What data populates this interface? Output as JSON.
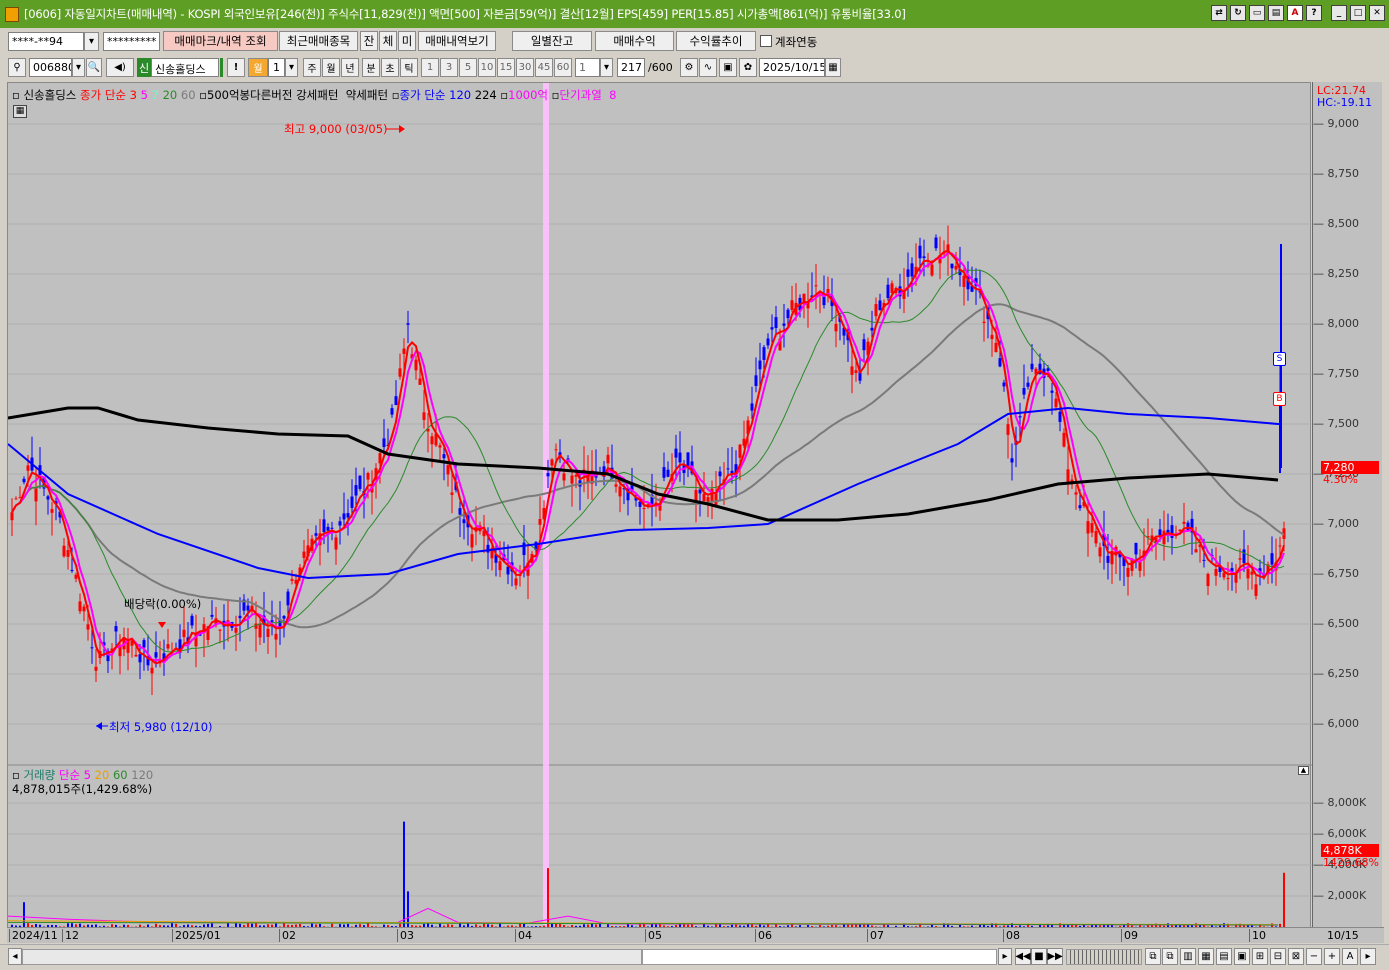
{
  "window": {
    "title": "[0606] 자동일지차트(매매내역) - KOSPI 외국인보유[246(천)] 주식수[11,829(천)] 액면[500] 자본금[59(억)] 결산[12월] EPS[459] PER[15.85] 시가총액[861(억)] 유통비율[33.0]"
  },
  "toolbar1": {
    "account": "****-**94",
    "password": "*********",
    "b1": "매매마크/내역 조회",
    "b2": "최근매매종목",
    "b3": "잔",
    "b4": "체",
    "b5": "미",
    "b6": "매매내역보기",
    "b7": "일별잔고",
    "b8": "매매수익",
    "b9": "수익률추이",
    "check_label": "계좌연동"
  },
  "toolbar2": {
    "code": "006880",
    "badge": "신",
    "name": "신송홀딩스",
    "excl": "!",
    "period_active": "월",
    "period_value": "1",
    "periods": [
      "주",
      "월",
      "년",
      "분",
      "초",
      "틱"
    ],
    "nums": [
      "1",
      "3",
      "5",
      "10",
      "15",
      "30",
      "45",
      "60"
    ],
    "num_sel": "1",
    "count": "217",
    "count_total": "/600",
    "date": "2025/10/15"
  },
  "legend_price": {
    "name": "신송홀딩스",
    "ma_label": "종가 단순",
    "p3": "3",
    "p5": "5",
    "p7": "7",
    "p20": "20",
    "p60": "60",
    "pattern": "500억봉다른버전 강세패턴",
    "weak": "약세패턴",
    "ma120": "종가 단순 120",
    "v224": "224",
    "v1000": "1000억",
    "short": "단기과열",
    "v8": "8"
  },
  "legend_volume": {
    "name": "거래량",
    "ma": "단순 5",
    "p20": "20",
    "p60": "60",
    "p120": "120",
    "value": "4,878,015주(1,429.68%)"
  },
  "annotations": {
    "high": "최고 9,000 (03/05)",
    "low": "최저 5,980 (12/10)",
    "div": "배당락(0.00%)",
    "S": "S",
    "B": "B"
  },
  "right_labels": {
    "lc": "LC:21.74",
    "hc": "HC:-19.11",
    "price": "7,280",
    "pct": "4.30%",
    "vol": "4,878K",
    "volpct": "1429.68%"
  },
  "price_ticks": [
    "9,000",
    "8,750",
    "8,500",
    "8,250",
    "8,000",
    "7,750",
    "7,500",
    "7,250",
    "7,000",
    "6,750",
    "6,500",
    "6,250",
    "6,000"
  ],
  "volume_ticks": [
    "8,000K",
    "6,000K",
    "4,000K",
    "2,000K"
  ],
  "x_labels": [
    "2024/11",
    "12",
    "2025/01",
    "02",
    "03",
    "04",
    "05",
    "06",
    "07",
    "08",
    "09",
    "10",
    "10/15"
  ],
  "colors": {
    "up": "#ff0000",
    "down": "#0000ff",
    "ma3": "#ff0000",
    "ma5": "#ff00ff",
    "ma20": "#2a8a2a",
    "ma60": "#7a7a7a",
    "ma120": "#0000ff",
    "ma224": "#000000",
    "pink": "#ffc0ff"
  },
  "chart_data": {
    "type": "candlestick",
    "title": "신송홀딩스",
    "high": {
      "value": 9000,
      "date": "03/05"
    },
    "low": {
      "value": 5980,
      "date": "12/10"
    },
    "last": {
      "close": 7280,
      "change_pct": 4.3,
      "date": "2025/10/15"
    },
    "ylim": [
      5850,
      9200
    ],
    "volume_last": 4878015
  }
}
